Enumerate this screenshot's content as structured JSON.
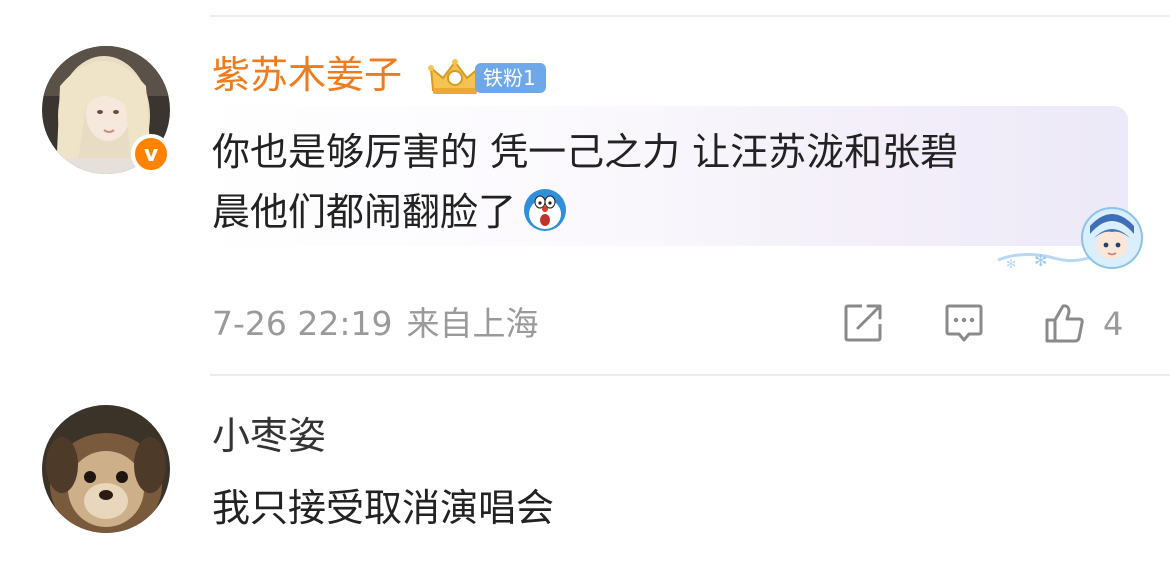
{
  "comments": [
    {
      "username": "紫苏木姜子",
      "fan_badge": "铁粉1",
      "verified_badge": "v",
      "text_line1": "你也是够厉害的 凭一己之力 让汪苏泷和张碧",
      "text_line2": "晨他们都闹翻脸了",
      "inline_emoji": "doraemon-shocked-emoji",
      "date": "7-26 22:19",
      "location": "来自上海",
      "like_count": "4",
      "actions": [
        "share-icon",
        "reply-icon",
        "like-icon"
      ]
    },
    {
      "username": "小枣姿",
      "text": "我只接受取消演唱会"
    }
  ],
  "colors": {
    "username_highlight": "#ef7b1c",
    "badge_blue": "#6fa8e8",
    "verified_orange": "#ff8200",
    "meta_gray": "#9a9a9a"
  }
}
